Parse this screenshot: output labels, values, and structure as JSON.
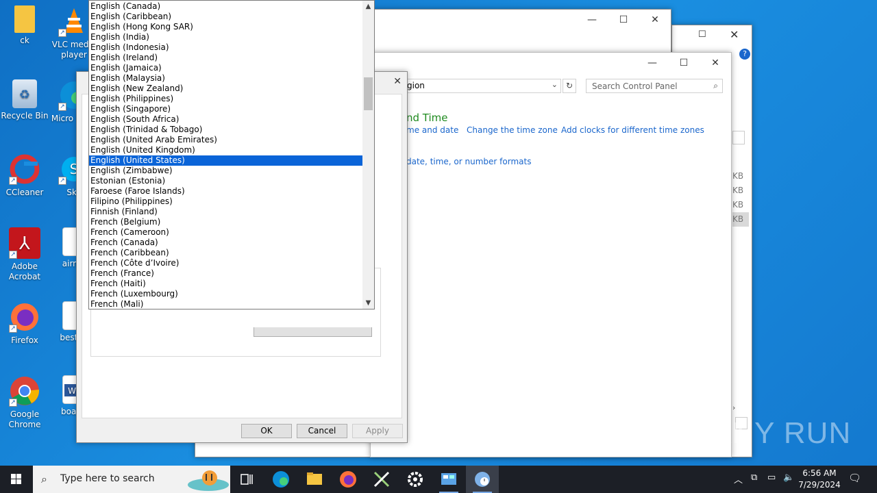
{
  "desktop": {
    "icons": [
      {
        "label": "ck"
      },
      {
        "label": "VLC media player"
      },
      {
        "label": "Recycle Bin"
      },
      {
        "label": "Micro Edge"
      },
      {
        "label": "CCleaner"
      },
      {
        "label": "Sky"
      },
      {
        "label": "Adobe Acrobat"
      },
      {
        "label": "airma"
      },
      {
        "label": "Firefox"
      },
      {
        "label": "bestriv"
      },
      {
        "label": "Google Chrome"
      },
      {
        "label": "boardi"
      }
    ]
  },
  "control_panel": {
    "address_text": "gion",
    "search_placeholder": "Search Control Panel",
    "section_title": "nd Time",
    "links": {
      "set_time": "me and date",
      "change_tz": "Change the time zone",
      "add_clocks": "Add clocks for different time zones",
      "formats": "date, time, or number formats"
    }
  },
  "background_window": {
    "kb_labels": [
      "KB",
      "KB",
      "KB",
      "KB"
    ]
  },
  "dialog": {
    "ok_label": "OK",
    "cancel_label": "Cancel",
    "apply_label": "Apply"
  },
  "language_list": {
    "selected_index": 15,
    "items": [
      "English (Canada)",
      "English (Caribbean)",
      "English (Hong Kong SAR)",
      "English (India)",
      "English (Indonesia)",
      "English (Ireland)",
      "English (Jamaica)",
      "English (Malaysia)",
      "English (New Zealand)",
      "English (Philippines)",
      "English (Singapore)",
      "English (South Africa)",
      "English (Trinidad & Tobago)",
      "English (United Arab Emirates)",
      "English (United Kingdom)",
      "English (United States)",
      "English (Zimbabwe)",
      "Estonian (Estonia)",
      "Faroese (Faroe Islands)",
      "Filipino (Philippines)",
      "Finnish (Finland)",
      "French (Belgium)",
      "French (Cameroon)",
      "French (Canada)",
      "French (Caribbean)",
      "French (Côte d’Ivoire)",
      "French (France)",
      "French (Haiti)",
      "French (Luxembourg)",
      "French (Mali)"
    ]
  },
  "taskbar": {
    "search_placeholder": "Type here to search",
    "time": "6:56 AM",
    "date": "7/29/2024"
  },
  "watermark": "ANY RUN",
  "colors": {
    "selection": "#0a64d8",
    "link": "#1a66cc",
    "section_title": "#1e8a1e",
    "taskbar": "#1c1f26"
  }
}
